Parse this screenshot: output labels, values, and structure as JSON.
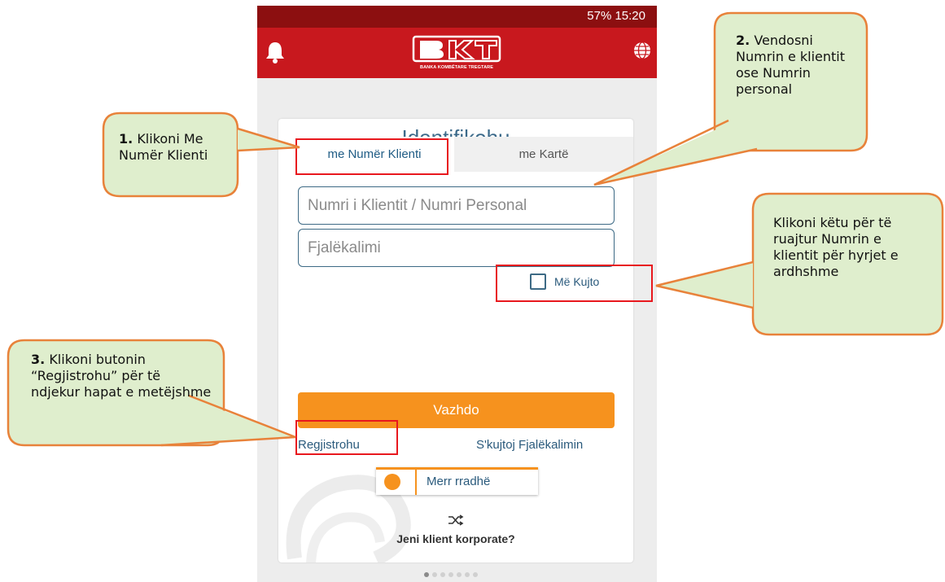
{
  "status_bar": {
    "text": "57% 15:20"
  },
  "app": {
    "logo_tagline": "BANKA KOMBËTARE TREGTARE"
  },
  "login": {
    "title": "Identifikohu",
    "tabs": [
      {
        "label": "me Numër Klienti",
        "active": true
      },
      {
        "label": "me Kartë",
        "active": false
      }
    ],
    "client_number_placeholder": "Numri i Klientit / Numri Personal",
    "password_placeholder": "Fjalëkalimi",
    "remember_label": "Më Kujto",
    "continue_button": "Vazhdo",
    "register_link": "Regjistrohu",
    "forgot_link": "S'kujtoj Fjalëkalimin",
    "queue_button": "Merr rradhë",
    "corporate_text": "Jeni klient korporate?"
  },
  "callouts": [
    {
      "num": "1.",
      "text": "Klikoni Me Numër Klienti"
    },
    {
      "num": "2.",
      "text": "Vendosni Numrin e klientit ose Numrin personal"
    },
    {
      "num": "",
      "text": "Klikoni këtu për të ruajtur Numrin e klientit për hyrjet e ardhshme"
    },
    {
      "num": "3.",
      "text": "Klikoni butonin “Regjistrohu” për të ndjekur hapat e metëjshme"
    }
  ],
  "colors": {
    "primary_red": "#c8181e",
    "dark_red": "#8c0f10",
    "orange": "#f6921e",
    "link_blue": "#2a5a7c",
    "callout_fill": "#dfeecd",
    "callout_border": "#e8823a",
    "highlight_red": "#e8181e"
  },
  "icons": [
    "bell-icon",
    "globe-icon",
    "checkbox-icon",
    "ticket-icon",
    "shuffle-icon"
  ]
}
